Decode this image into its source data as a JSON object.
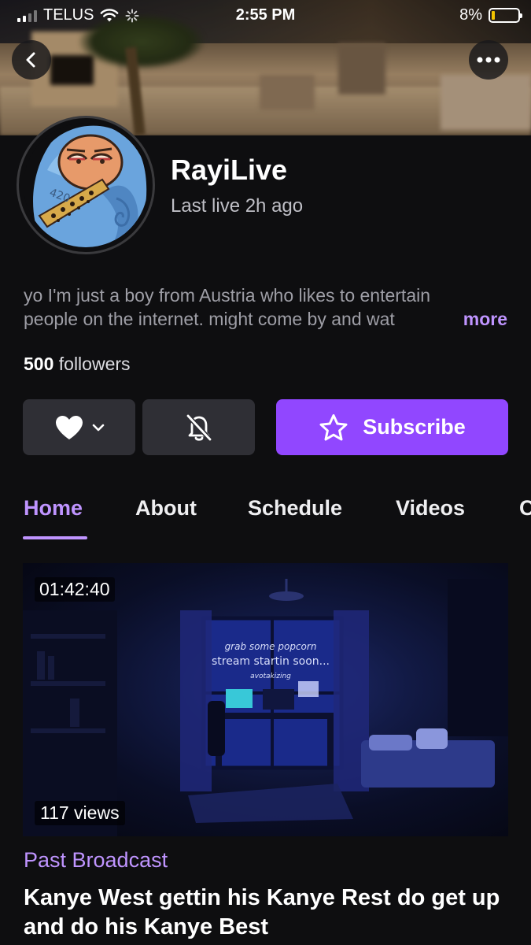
{
  "status_bar": {
    "carrier": "TELUS",
    "time": "2:55 PM",
    "battery": "8%",
    "battery_level": 0.08
  },
  "nav": {
    "back_icon": "chevron-left-icon",
    "more_icon": "ellipsis-icon"
  },
  "profile": {
    "name": "RayiLive",
    "last_live": "Last live 2h ago",
    "bio_line1": "yo I'm just a  boy from Austria who likes to entertain",
    "bio_line2": "people on the internet. might come by and wat",
    "more_label": "more",
    "followers_count": "500",
    "followers_label": "followers"
  },
  "actions": {
    "follow_icon": "heart-icon",
    "notify_icon": "bell-off-icon",
    "subscribe_label": "Subscribe",
    "subscribe_icon": "star-icon"
  },
  "tabs": [
    {
      "label": "Home",
      "active": true
    },
    {
      "label": "About",
      "active": false
    },
    {
      "label": "Schedule",
      "active": false
    },
    {
      "label": "Videos",
      "active": false
    },
    {
      "label": "C",
      "active": false
    }
  ],
  "video": {
    "duration": "01:42:40",
    "views": "117 views",
    "thumbnail_text_1": "grab some popcorn",
    "thumbnail_text_2": "stream startin soon...",
    "thumbnail_text_3": "avotakizing",
    "category": "Past Broadcast",
    "title": "Kanye West gettin his Kanye Rest do get up and do his Kanye Best"
  },
  "colors": {
    "accent": "#9147ff",
    "accent_text": "#bf94ff",
    "background": "#0e0e10",
    "button_bg": "#2f2f35"
  }
}
